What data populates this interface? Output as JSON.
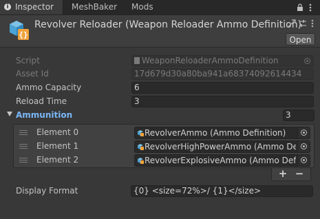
{
  "tabs": [
    {
      "label": "Inspector",
      "active": true
    },
    {
      "label": "MeshBaker",
      "active": false
    },
    {
      "label": "Mods",
      "active": false
    }
  ],
  "tab_icons": {
    "info": "info-icon",
    "menu": "kebab-menu-icon",
    "lock": "lock-icon"
  },
  "header": {
    "title": "Revolver Reloader (Weapon Reloader Ammo Definition)",
    "open_label": "Open",
    "icons": [
      "scriptable-object-icon",
      "preset-icon",
      "settings-sliders-icon",
      "kebab-menu-icon"
    ]
  },
  "fields": {
    "script": {
      "label": "Script",
      "value": "WeaponReloaderAmmoDefinition"
    },
    "asset_id": {
      "label": "Asset Id",
      "value": "17d679d30a80ba941a68374092614434"
    },
    "ammo_capacity": {
      "label": "Ammo Capacity",
      "value": "6"
    },
    "reload_time": {
      "label": "Reload Time",
      "value": "3"
    },
    "display_format": {
      "label": "Display Format",
      "value": "{0} <size=72%>/ {1}</size>"
    }
  },
  "ammunition": {
    "label": "Ammunition",
    "count": "3",
    "elements": [
      {
        "label": "Element 0",
        "value": "RevolverAmmo (Ammo Definition)"
      },
      {
        "label": "Element 1",
        "value": "RevolverHighPowerAmmo (Ammo Definition)"
      },
      {
        "label": "Element 2",
        "value": "RevolverExplosiveAmmo (Ammo Definition)"
      }
    ],
    "add_label": "+",
    "remove_label": "−"
  },
  "colors": {
    "background": "#383838",
    "accent_label": "#7ab7f7",
    "field_bg": "#2a2a2a"
  }
}
